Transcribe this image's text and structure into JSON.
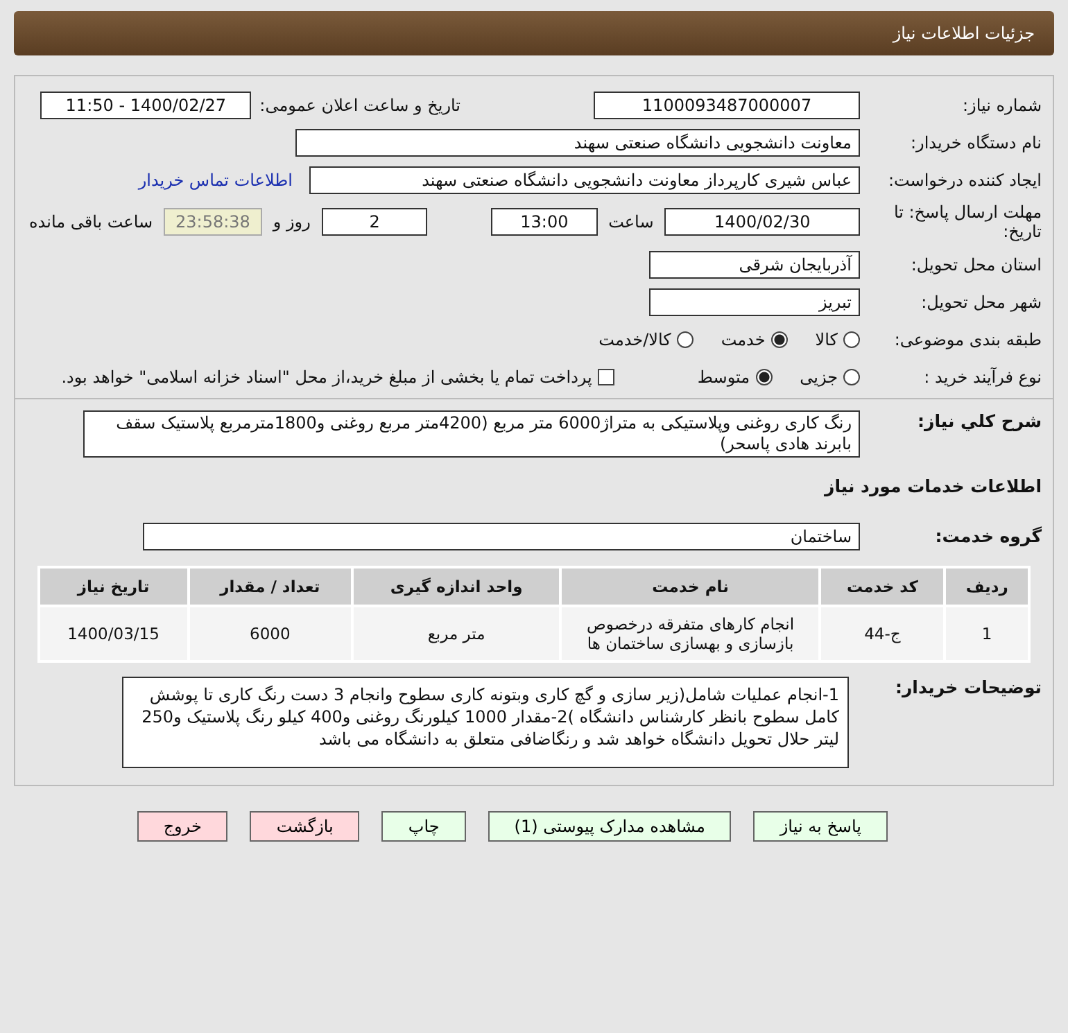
{
  "header": {
    "title": "جزئیات اطلاعات نیاز"
  },
  "fields": {
    "need_number": {
      "label": "شماره نیاز:",
      "value": "1100093487000007"
    },
    "announce": {
      "label": "تاریخ و ساعت اعلان عمومی:",
      "value": "1400/02/27 - 11:50"
    },
    "buyer": {
      "label": "نام دستگاه خریدار:",
      "value": "معاونت دانشجویی دانشگاه صنعتی سهند"
    },
    "creator": {
      "label": "ایجاد کننده درخواست:",
      "value": "عباس شیری کارپرداز معاونت دانشجویی دانشگاه صنعتی سهند",
      "link": "اطلاعات تماس خریدار"
    },
    "deadline": {
      "label": "مهلت ارسال پاسخ: تا تاریخ:",
      "date": "1400/02/30",
      "time_label": "ساعت",
      "time": "13:00",
      "days": "2",
      "days_label": "روز و",
      "remaining": "23:58:38",
      "remaining_label": "ساعت باقی مانده"
    },
    "province": {
      "label": "استان محل تحویل:",
      "value": "آذربایجان شرقی"
    },
    "city": {
      "label": "شهر محل تحویل:",
      "value": "تبریز"
    }
  },
  "category": {
    "label": "طبقه بندی موضوعی:",
    "options": [
      {
        "label": "کالا",
        "selected": false
      },
      {
        "label": "خدمت",
        "selected": true
      },
      {
        "label": "کالا/خدمت",
        "selected": false
      }
    ]
  },
  "process": {
    "label": "نوع فرآیند خرید :",
    "options": [
      {
        "label": "جزیی",
        "selected": false
      },
      {
        "label": "متوسط",
        "selected": true
      }
    ],
    "payment": {
      "label": "پرداخت تمام یا بخشی از مبلغ خرید،از محل \"اسناد خزانه اسلامی\" خواهد بود.",
      "checked": false
    }
  },
  "summary": {
    "label": "شرح کلي نياز:",
    "value": "رنگ کاری روغنی وپلاستیکی به متراژ6000 متر مربع (4200متر مربع روغنی و1800مترمربع پلاستیک سقف بابرند هادی پاسحر)"
  },
  "services_title": "اطلاعات خدمات مورد نیاز",
  "service_group": {
    "label": "گروه خدمت:",
    "value": "ساختمان"
  },
  "table": {
    "columns": [
      "ردیف",
      "کد خدمت",
      "نام خدمت",
      "واحد اندازه گیری",
      "تعداد / مقدار",
      "تاریخ نیاز"
    ],
    "rows": [
      [
        "1",
        "ج-44",
        "انجام کارهای متفرقه درخصوص بازسازی و بهسازی ساختمان ها",
        "متر مربع",
        "6000",
        "1400/03/15"
      ]
    ]
  },
  "notes": {
    "label": "توضیحات خریدار:",
    "value": "1-انجام عملیات شامل(زیر سازی و گچ کاری وبتونه کاری سطوح وانجام 3 دست رنگ کاری تا پوشش کامل سطوح بانظر کارشناس دانشگاه )2-مقدار 1000 کیلورنگ روغنی و400 کیلو رنگ پلاستیک و250 لیتر حلال تحویل دانشگاه خواهد شد و رنگاضافی متعلق به دانشگاه می باشد"
  },
  "buttons": [
    {
      "label": "پاسخ به نیاز",
      "kind": "normal"
    },
    {
      "label": "مشاهده مدارک پیوستی (1)",
      "kind": "normal"
    },
    {
      "label": "چاپ",
      "kind": "normal"
    },
    {
      "label": "بازگشت",
      "kind": "danger"
    },
    {
      "label": "خروج",
      "kind": "danger"
    }
  ]
}
